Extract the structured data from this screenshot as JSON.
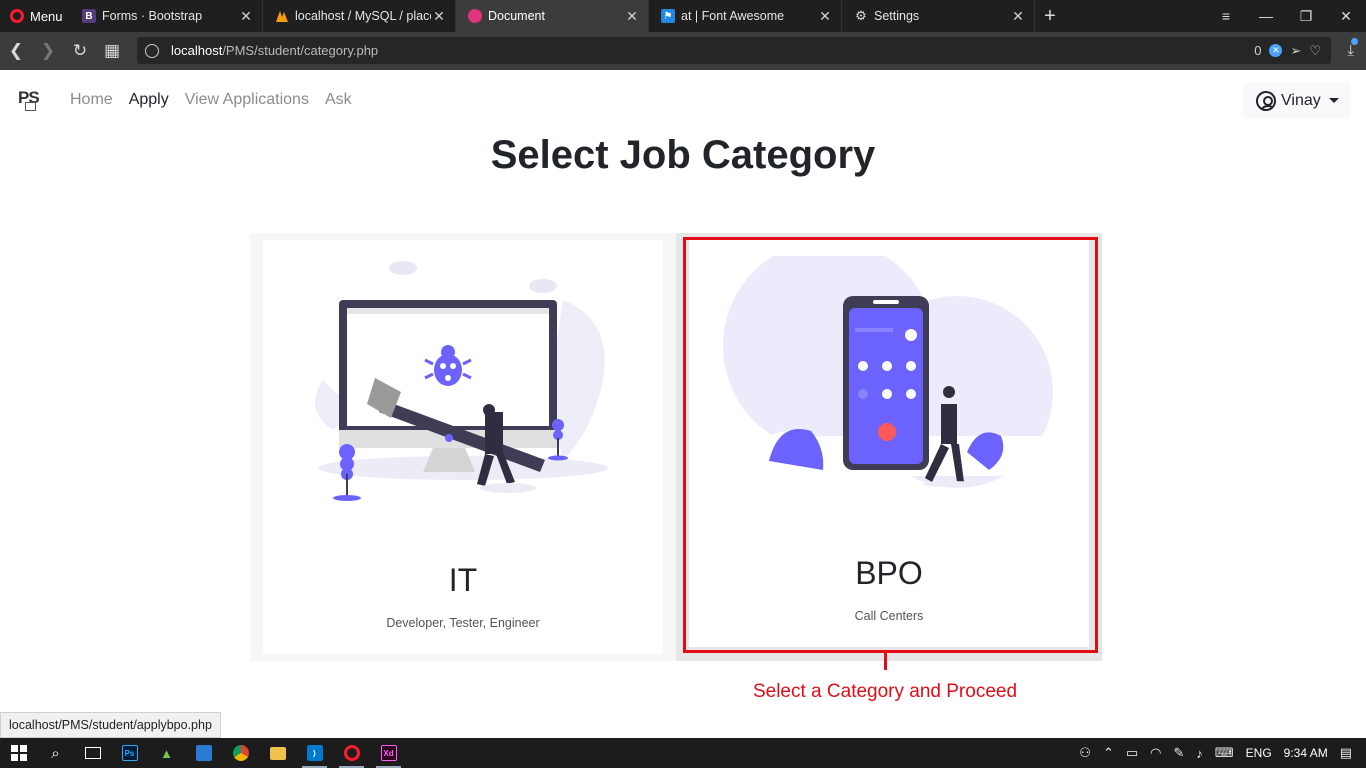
{
  "browser": {
    "menu_label": "Menu",
    "tabs": [
      {
        "title": "Forms · Bootstrap",
        "favicon": "bootstrap-icon",
        "color": "#563d7c",
        "glyph": "B"
      },
      {
        "title": "localhost / MySQL / placement",
        "favicon": "phpmyadmin-icon",
        "color": "#f89c0e",
        "glyph": ""
      },
      {
        "title": "Document",
        "favicon": "document-icon",
        "color": "#e0337d",
        "glyph": ""
      },
      {
        "title": "at | Font Awesome",
        "favicon": "flag-icon",
        "color": "#228ae6",
        "glyph": "⚑"
      },
      {
        "title": "Settings",
        "favicon": "gear-icon",
        "color": "#3c3c3c",
        "glyph": "⚙"
      }
    ],
    "active_tab_index": 2,
    "url_host": "localhost",
    "url_path": "/PMS/student/category.php",
    "adblock_count": "0"
  },
  "navbar": {
    "brand": "PS",
    "links": [
      {
        "label": "Home",
        "active": false
      },
      {
        "label": "Apply",
        "active": true
      },
      {
        "label": "View Applications",
        "active": false
      },
      {
        "label": "Ask",
        "active": false
      }
    ],
    "user_name": "Vinay"
  },
  "page": {
    "title": "Select Job Category",
    "categories": [
      {
        "title": "IT",
        "subtitle": "Developer, Tester, Engineer",
        "illustration": "bug-fixing-illustration"
      },
      {
        "title": "BPO",
        "subtitle": "Call Centers",
        "illustration": "phone-call-illustration"
      }
    ]
  },
  "annotation": {
    "label": "Select a Category and Proceed",
    "color": "#e00d16"
  },
  "status_url": "localhost/PMS/student/applybpo.php",
  "taskbar": {
    "language": "ENG",
    "time": "9:34 AM"
  }
}
